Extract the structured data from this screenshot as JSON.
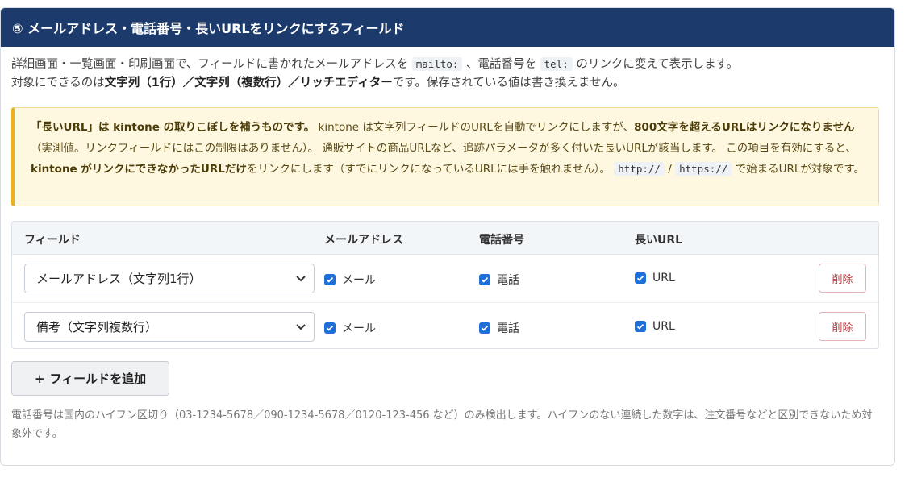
{
  "header": {
    "title": "⑤ メールアドレス・電話番号・長いURLをリンクにするフィールド"
  },
  "description": {
    "line1_a": "詳細画面・一覧画面・印刷画面で、フィールドに書かれたメールアドレスを ",
    "code_mailto": "mailto:",
    "line1_b": " 、電話番号を ",
    "code_tel": "tel:",
    "line1_c": " のリンクに変えて表示します。",
    "line2_a": "対象にできるのは",
    "line2_bold": "文字列（1行）／文字列（複数行）／リッチエディター",
    "line2_b": "です。保存されている値は書き換えません。"
  },
  "notice": {
    "bold1": "「長いURL」は kintone の取りこぼしを補うものです。",
    "text1": " kintone は文字列フィールドのURLを自動でリンクにしますが、",
    "bold2": "800文字を超えるURLはリンクになりません",
    "text2": "（実測値。リンクフィールドにはこの制限はありません）。 通販サイトの商品URLなど、追跡パラメータが多く付いた長いURLが該当します。 この項目を有効にすると、",
    "bold3": "kintone がリンクにできなかったURLだけ",
    "text3": "をリンクにします（すでにリンクになっているURLには手を触れません）。 ",
    "code_http": "http://",
    "sep": " / ",
    "code_https": "https://",
    "text4": " で始まるURLが対象です。"
  },
  "table": {
    "headers": {
      "field": "フィールド",
      "email": "メールアドレス",
      "phone": "電話番号",
      "url": "長いURL"
    },
    "rows": [
      {
        "field": "メールアドレス（文字列1行）",
        "email_label": "メール",
        "email_checked": true,
        "phone_label": "電話",
        "phone_checked": true,
        "url_label": "URL",
        "url_checked": true,
        "delete_label": "削除"
      },
      {
        "field": "備考（文字列複数行）",
        "email_label": "メール",
        "email_checked": true,
        "phone_label": "電話",
        "phone_checked": true,
        "url_label": "URL",
        "url_checked": true,
        "delete_label": "削除"
      }
    ]
  },
  "add_button": {
    "plus": "+",
    "label": "フィールドを追加"
  },
  "footnote": "電話番号は国内のハイフン区切り（03-1234-5678／090-1234-5678／0120-123-456 など）のみ検出します。ハイフンのない連続した数字は、注文番号などと区別できないため対象外です。",
  "colors": {
    "header_bg": "#1c3a6b",
    "checkbox": "#1f6fd8",
    "notice_bg": "#fff8e1",
    "notice_border": "#e9b319",
    "delete_text": "#c0393f"
  },
  "icons": {
    "chevron": "chevron-down-icon",
    "check": "check-icon"
  }
}
